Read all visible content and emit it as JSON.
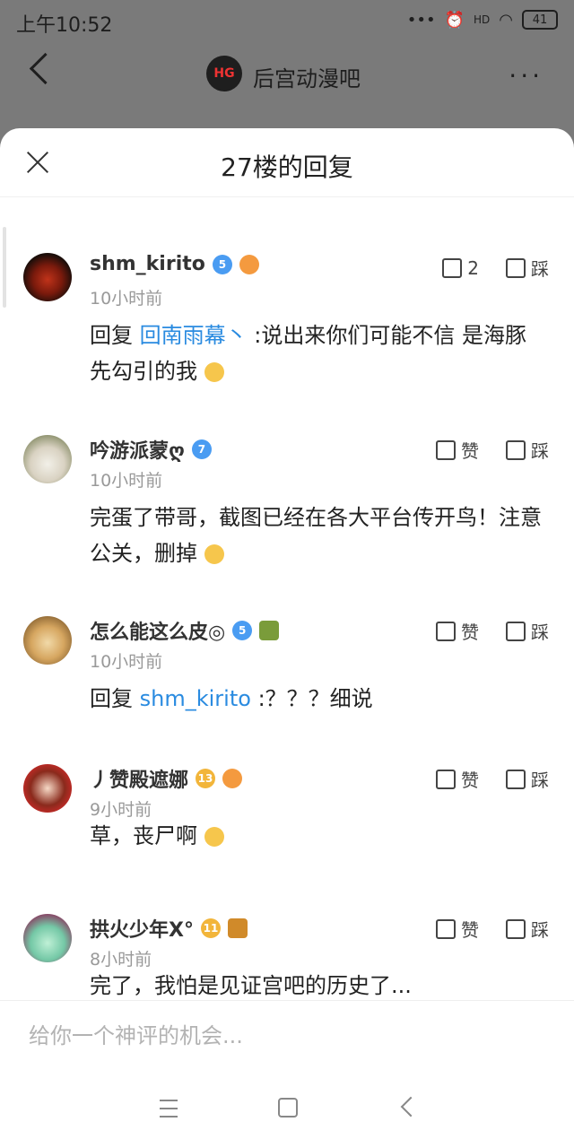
{
  "status": {
    "time": "上午10:52",
    "network": "HD",
    "battery": "41"
  },
  "forum": {
    "name": "后宫动漫吧"
  },
  "sheet": {
    "title": "27楼的回复"
  },
  "labels": {
    "like": "赞",
    "dislike": "踩",
    "reply_prefix": "回复"
  },
  "comments": [
    {
      "user": "shm_kirito",
      "level": "5",
      "time": "10小时前",
      "likes": "2",
      "mention": "回南雨幕丶",
      "text": ":说出来你们可能不信 是海豚先勾引的我"
    },
    {
      "user": "吟游派蒙ღ",
      "level": "7",
      "time": "10小时前",
      "likes": "赞",
      "text": "完蛋了带哥，截图已经在各大平台传开鸟！注意公关，删掉"
    },
    {
      "user": "怎么能这么皮◎",
      "level": "5",
      "time": "10小时前",
      "likes": "赞",
      "mention": "shm_kirito",
      "text": ":？？？细说"
    },
    {
      "user": "丿赞殿遮娜",
      "level": "13",
      "time": "9小时前",
      "likes": "赞",
      "text": "草，丧尸啊"
    },
    {
      "user": "拱火少年X°",
      "level": "11",
      "time": "8小时前",
      "likes": "赞",
      "text": "完了，我怕是见证宫吧的历史了..."
    }
  ],
  "input": {
    "placeholder": "给你一个神评的机会..."
  },
  "colors": {
    "accent": "#2a8be0",
    "level_blue": "#4a9cf2",
    "level_gold": "#f2b53a"
  }
}
